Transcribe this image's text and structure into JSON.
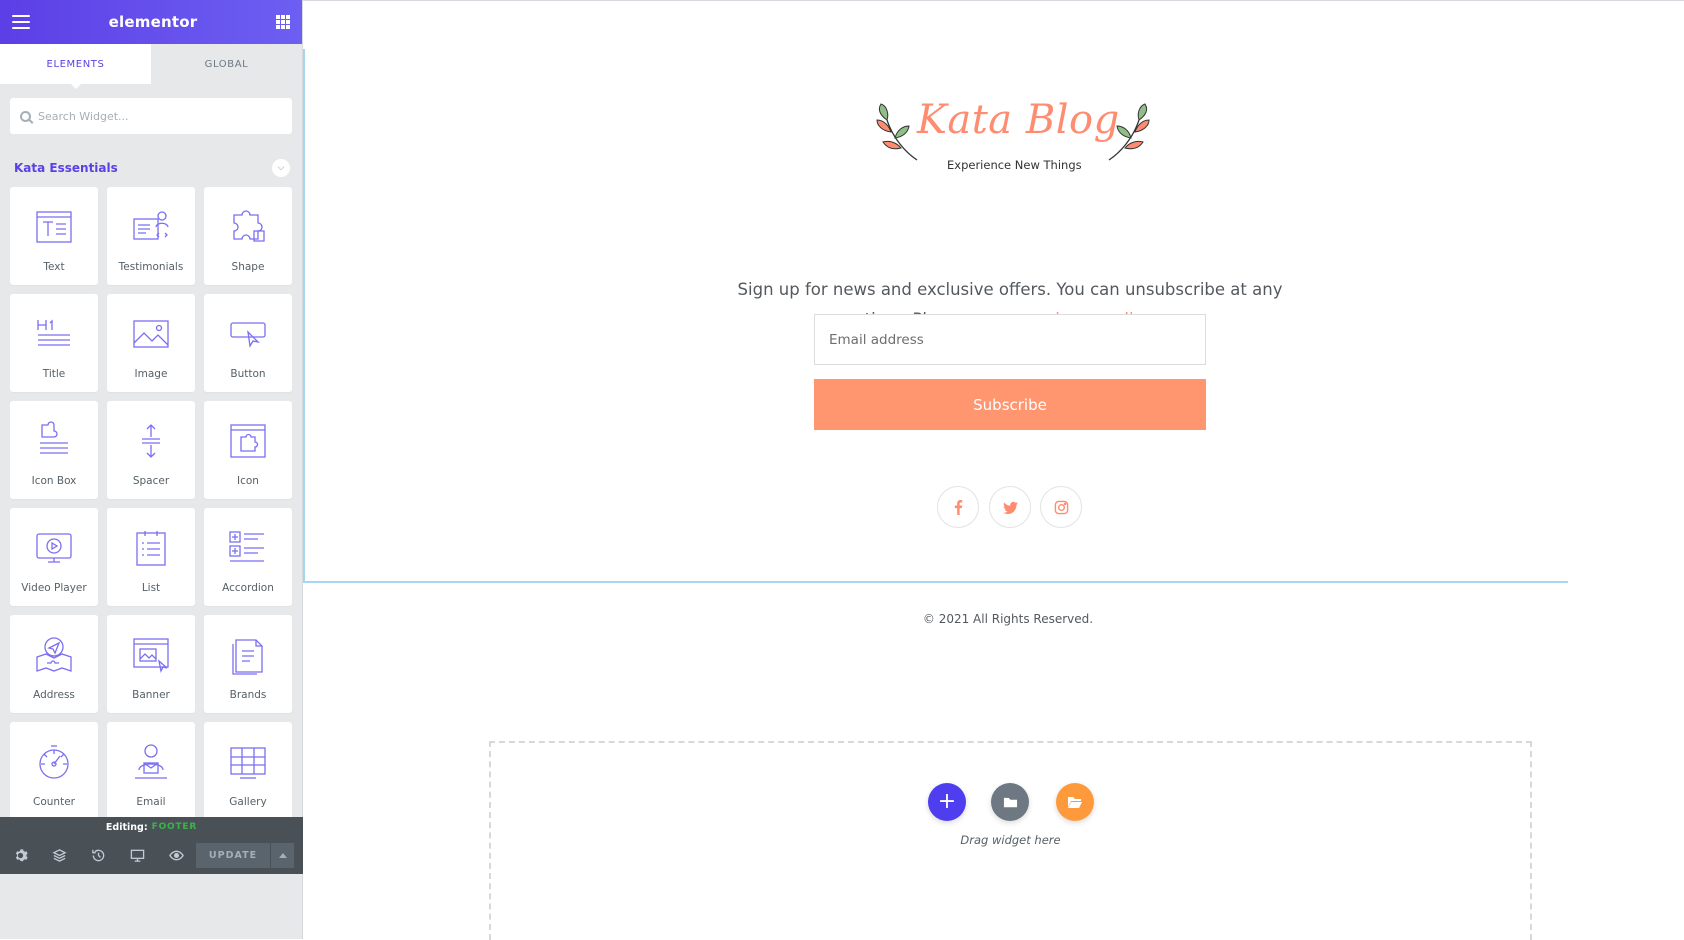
{
  "panel": {
    "header_title": "elementor",
    "tabs": [
      {
        "label": "ELEMENTS",
        "active": true
      },
      {
        "label": "GLOBAL",
        "active": false
      }
    ],
    "search_placeholder": "Search Widget...",
    "category_title": "Kata Essentials",
    "widgets": [
      {
        "label": "Text",
        "icon": "text-icon"
      },
      {
        "label": "Testimonials",
        "icon": "testimonials-icon"
      },
      {
        "label": "Shape",
        "icon": "puzzle-icon"
      },
      {
        "label": "Title",
        "icon": "heading-icon"
      },
      {
        "label": "Image",
        "icon": "image-icon"
      },
      {
        "label": "Button",
        "icon": "button-icon"
      },
      {
        "label": "Icon Box",
        "icon": "icon-box-icon"
      },
      {
        "label": "Spacer",
        "icon": "spacer-icon"
      },
      {
        "label": "Icon",
        "icon": "icon-icon"
      },
      {
        "label": "Video Player",
        "icon": "video-icon"
      },
      {
        "label": "List",
        "icon": "list-icon"
      },
      {
        "label": "Accordion",
        "icon": "accordion-icon"
      },
      {
        "label": "Address",
        "icon": "map-icon"
      },
      {
        "label": "Banner",
        "icon": "banner-icon"
      },
      {
        "label": "Brands",
        "icon": "brands-icon"
      },
      {
        "label": "Counter",
        "icon": "counter-icon"
      },
      {
        "label": "Email",
        "icon": "email-icon"
      },
      {
        "label": "Gallery",
        "icon": "gallery-icon"
      }
    ],
    "editing_label": "Editing:",
    "editing_name": "FOOTER",
    "update_label": "UPDATE"
  },
  "site": {
    "brand_name": "Kata Blog",
    "tagline": "Experience New Things",
    "signup_text_1": "Sign up for news and exclusive offers. You can unsubscribe at any time. Please see our ",
    "privacy_link": "privacy policy",
    "signup_text_2": ".",
    "email_placeholder": "Email address",
    "subscribe_label": "Subscribe",
    "copyright": "© 2021 All Rights Reserved.",
    "drag_text": "Drag widget here"
  },
  "colors": {
    "accent": "#5c3fe6",
    "brand": "#ff8c70",
    "button": "#ff9670",
    "editing_name": "#39b54a"
  }
}
